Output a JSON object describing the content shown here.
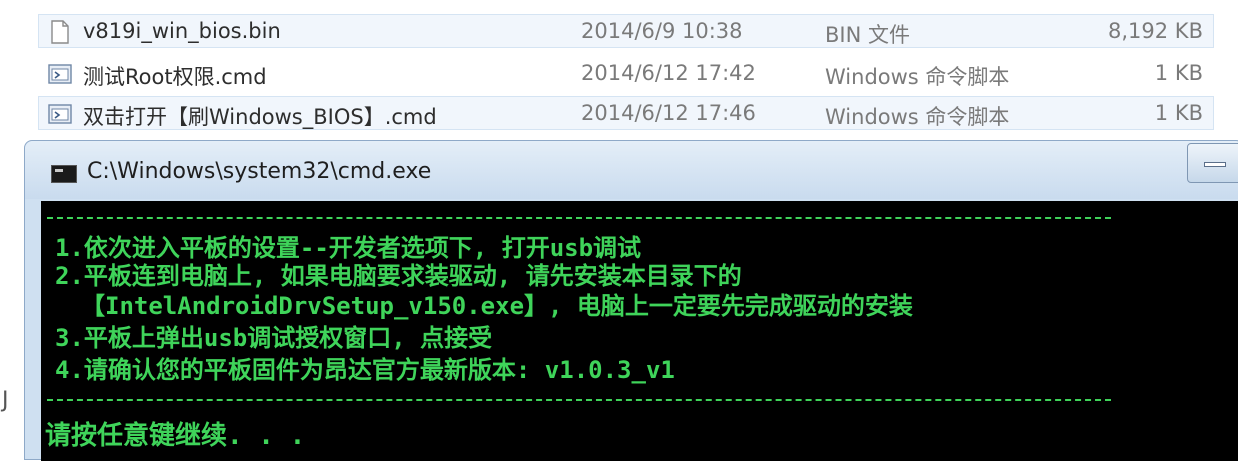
{
  "files": [
    {
      "name": "v819i_win_bios.bin",
      "date": "2014/6/9 10:38",
      "type": "BIN 文件",
      "size": "8,192 KB",
      "icon": "file-icon",
      "selected": true
    },
    {
      "name": "测试Root权限.cmd",
      "date": "2014/6/12 17:42",
      "type": "Windows 命令脚本",
      "size": "1 KB",
      "icon": "cmd-script-icon",
      "selected": false
    },
    {
      "name": "双击打开【刷Windows_BIOS】.cmd",
      "date": "2014/6/12 17:46",
      "type": "Windows 命令脚本",
      "size": "1 KB",
      "icon": "cmd-script-icon",
      "selected": true
    }
  ],
  "cmd_window": {
    "title": "C:\\Windows\\system32\\cmd.exe",
    "lines": [
      "1.依次进入平板的设置--开发者选项下, 打开usb调试",
      "2.平板连到电脑上, 如果电脑要求装驱动, 请先安装本目录下的",
      "【IntelAndroidDrvSetup_v150.exe】, 电脑上一定要先完成驱动的安装",
      "3.平板上弹出usb调试授权窗口, 点接受",
      "4.请确认您的平板固件为昂达官方最新版本: v1.0.3_v1"
    ],
    "prompt": "请按任意键继续. . ."
  },
  "edge_mark": "J",
  "colors": {
    "console_text": "#3fd45a",
    "console_bg": "#000000",
    "selection": "#f1f6fc"
  }
}
